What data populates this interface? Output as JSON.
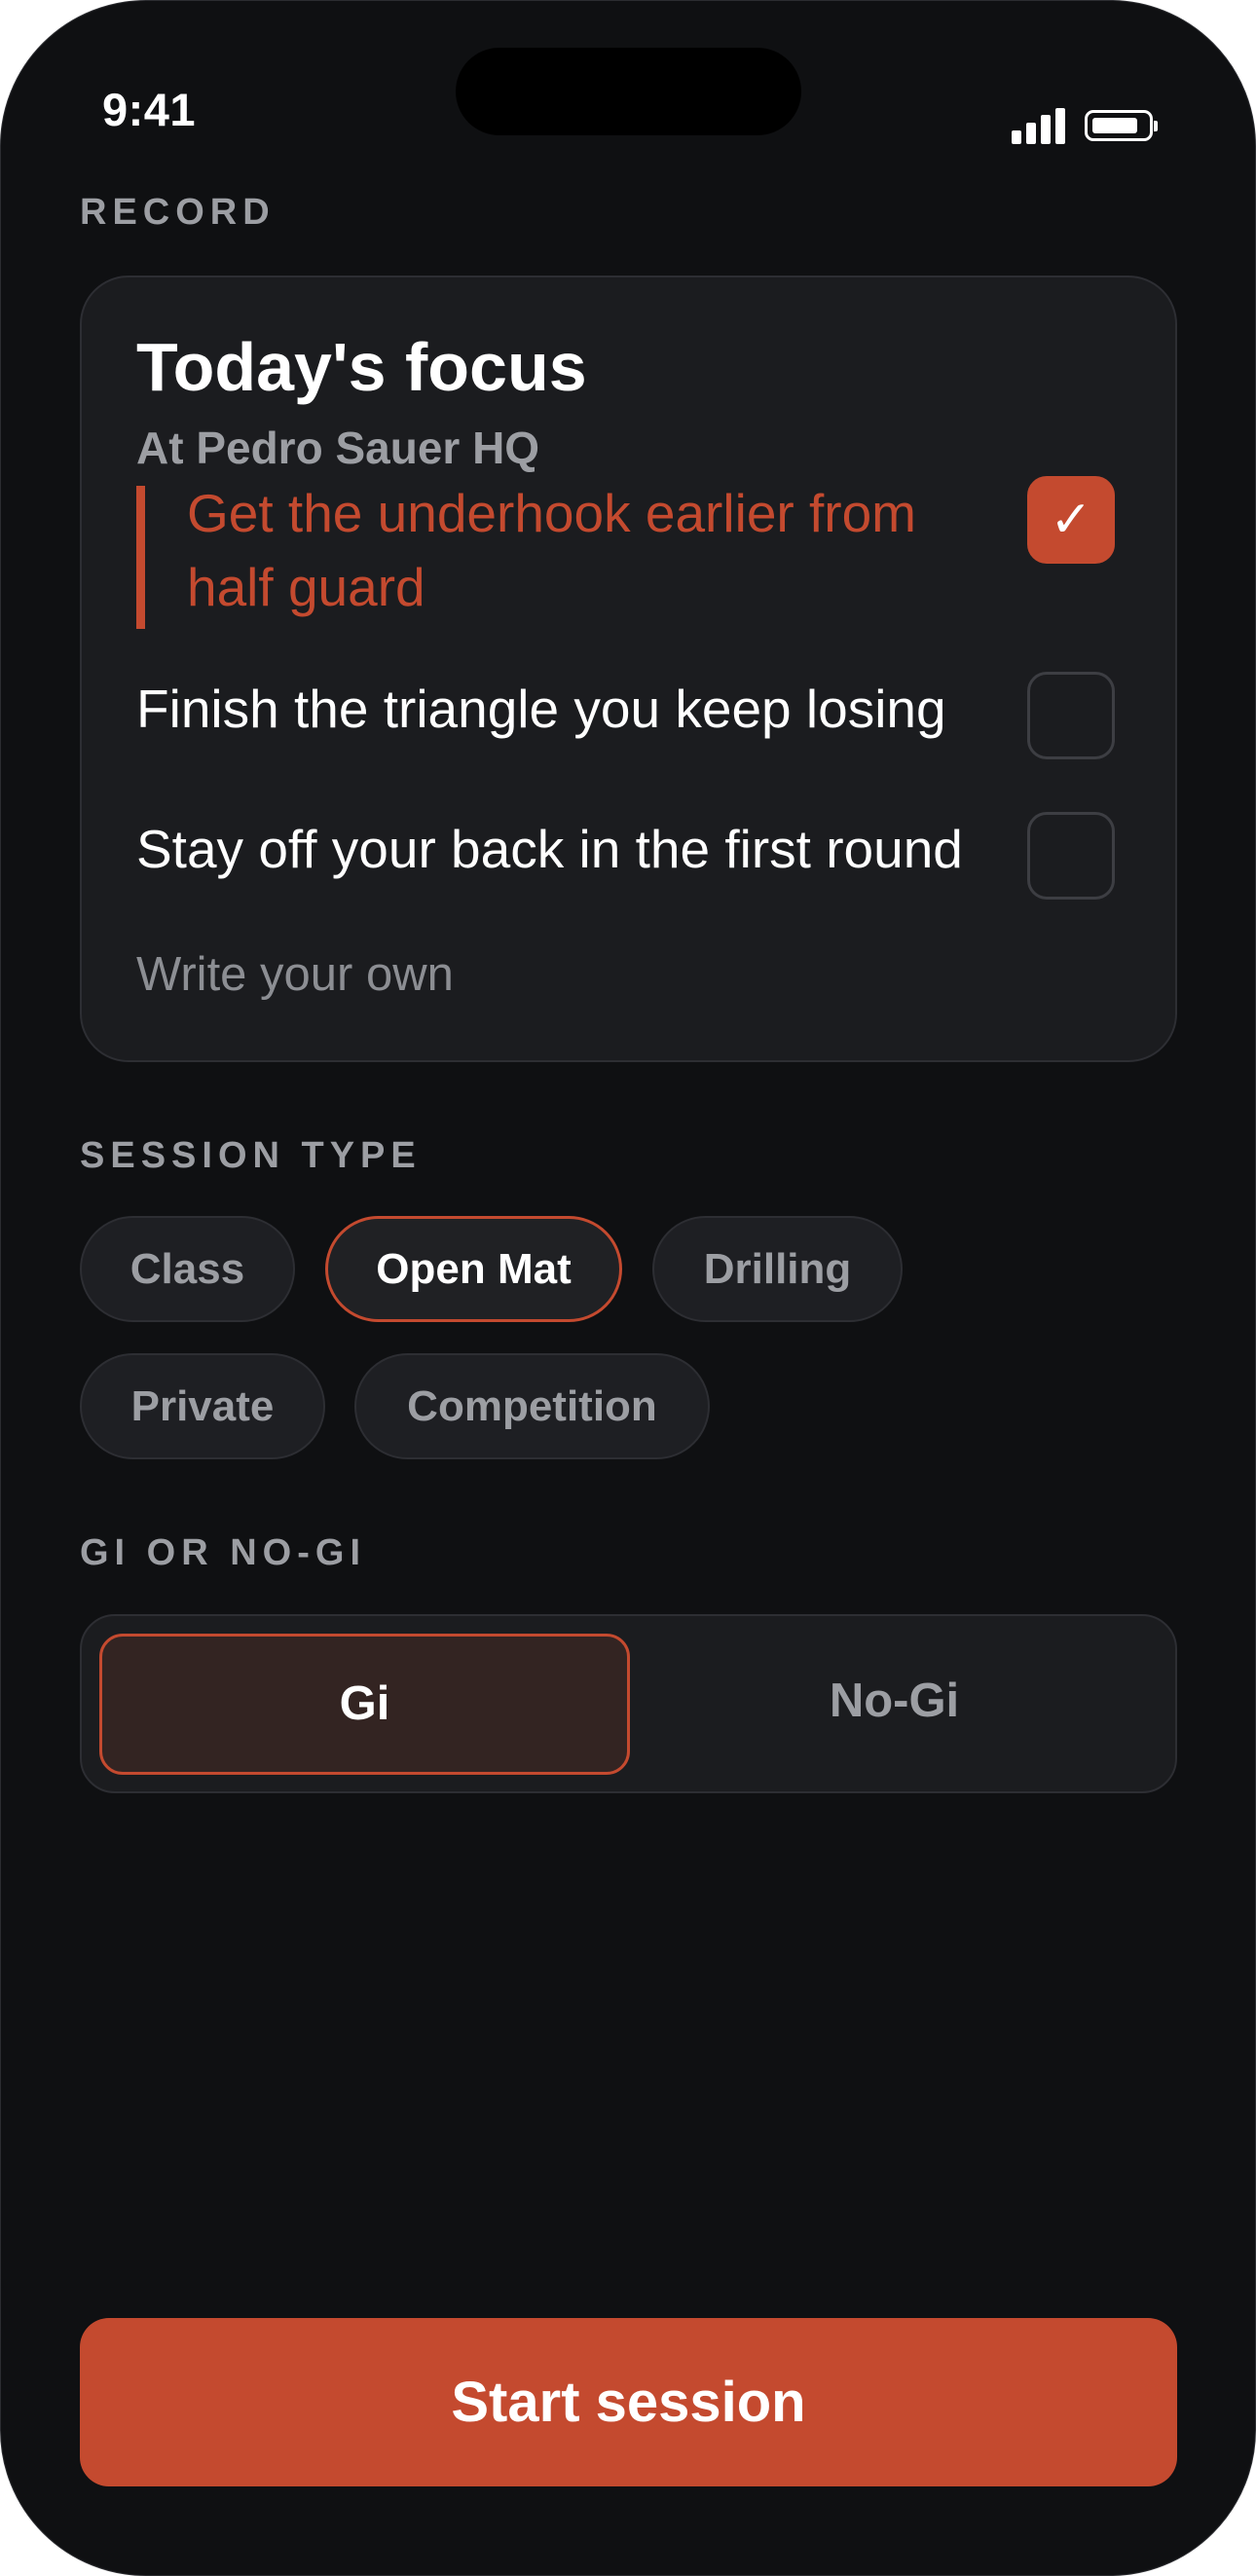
{
  "status_bar": {
    "time": "9:41",
    "icons": [
      "cellular-signal-icon",
      "battery-icon"
    ]
  },
  "record": {
    "section_label": "RECORD",
    "focus_card": {
      "title": "Today's focus",
      "subtitle": "At Pedro Sauer HQ",
      "items": [
        {
          "text": "Get the underhook earlier from half guard",
          "checked": true
        },
        {
          "text": "Finish the triangle you keep losing",
          "checked": false
        },
        {
          "text": "Stay off your back in the first round",
          "checked": false
        }
      ],
      "write_own_placeholder": "Write your own",
      "check_glyph": "✓"
    }
  },
  "session_type": {
    "section_label": "SESSION TYPE",
    "options": [
      "Class",
      "Open Mat",
      "Drilling",
      "Private",
      "Competition"
    ],
    "selected": "Open Mat"
  },
  "gi_choice": {
    "section_label": "GI OR NO-GI",
    "options": [
      "Gi",
      "No-Gi"
    ],
    "selected": "Gi"
  },
  "footer": {
    "start_label": "Start session"
  },
  "colors": {
    "background": "#0f1012",
    "card": "#1b1c1f",
    "accent": "#c44a2f",
    "muted_text": "#9c9ea3",
    "text": "#ffffff"
  }
}
